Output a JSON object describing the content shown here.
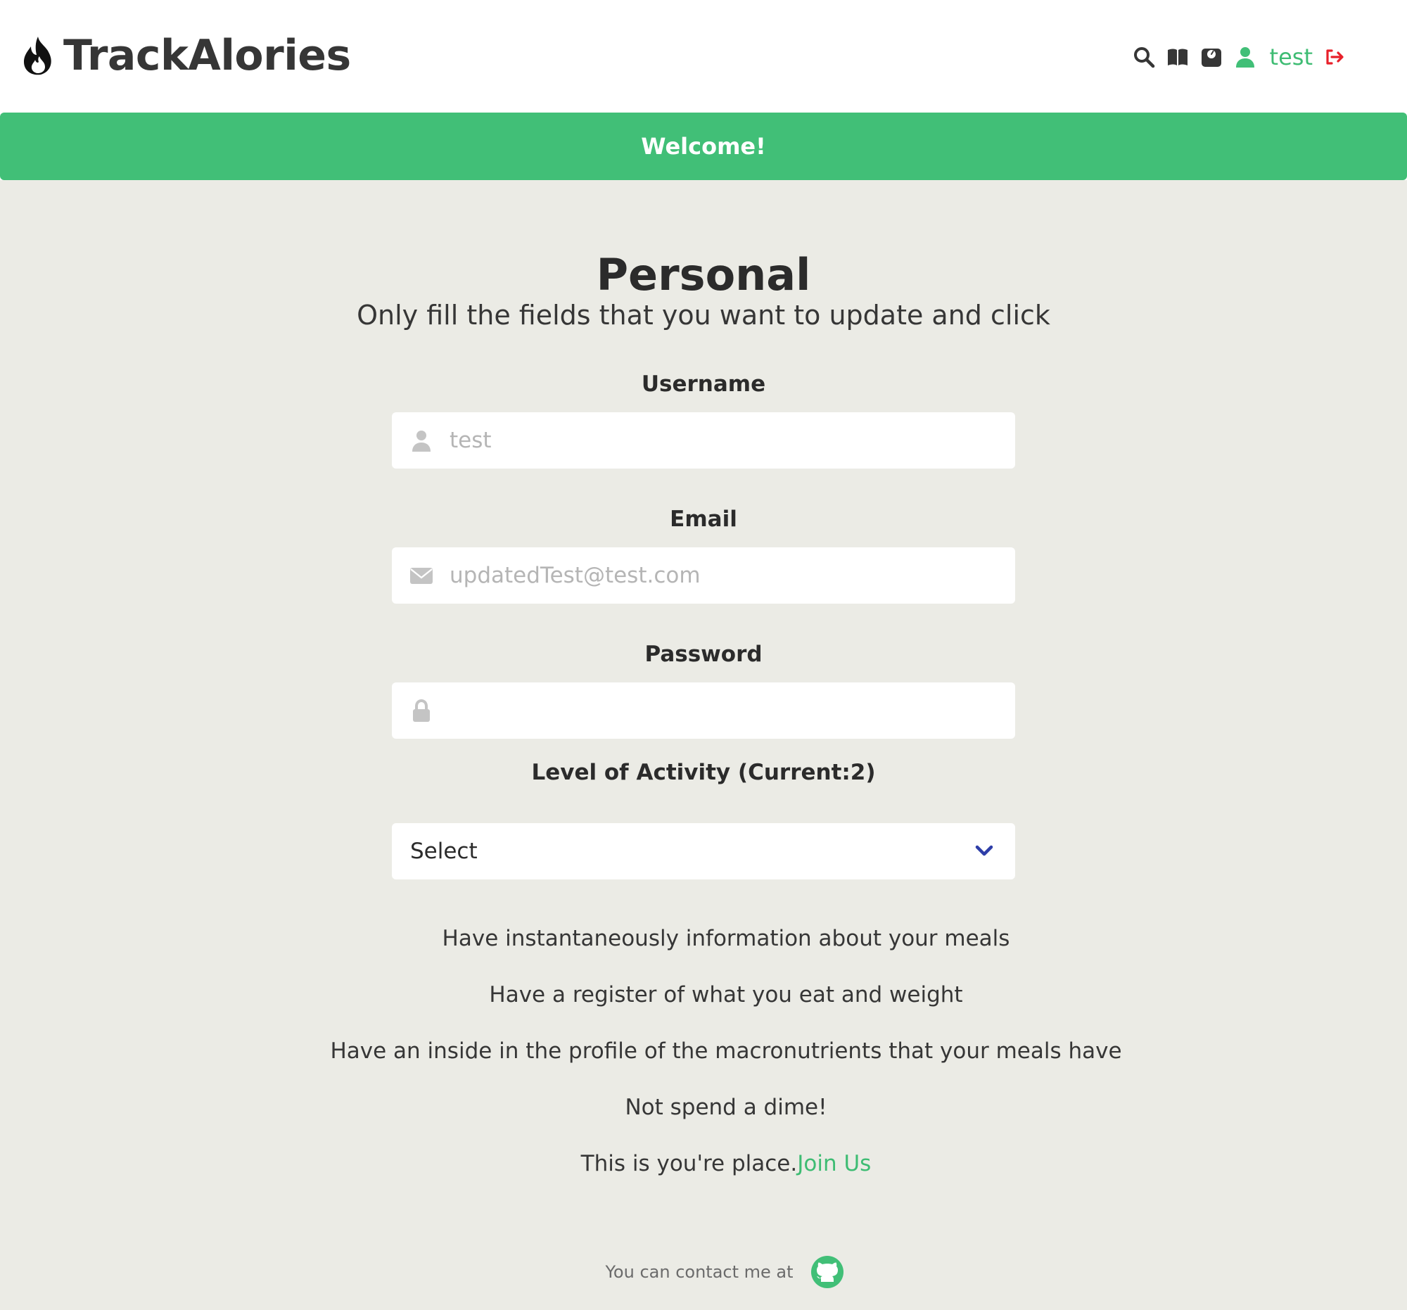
{
  "app": {
    "name": "TrackAlories",
    "logo_icon": "fire-icon"
  },
  "nav": {
    "icons": [
      "search-icon",
      "book-icon",
      "weight-scale-icon",
      "user-icon"
    ],
    "username": "test",
    "logout_icon": "sign-out-icon"
  },
  "banner": {
    "message": "Welcome!"
  },
  "form": {
    "title": "Personal",
    "subtitle": "Only fill the fields that you want to update and click",
    "username": {
      "label": "Username",
      "placeholder": "test",
      "value": "",
      "icon": "user-icon"
    },
    "email": {
      "label": "Email",
      "placeholder": "updatedTest@test.com",
      "value": "",
      "icon": "envelope-icon"
    },
    "password": {
      "label": "Password",
      "placeholder": "",
      "value": "",
      "icon": "lock-icon"
    },
    "activity": {
      "label": "Level of Activity (Current:2)",
      "selected": "Select"
    }
  },
  "features": [
    "Have instantaneously information about your meals",
    "Have a register of what you eat and weight",
    "Have an inside in the profile of the macronutrients that your meals have",
    "Not spend a dime!"
  ],
  "cta": {
    "text": "This is you're place.",
    "link": "Join Us"
  },
  "footer": {
    "text": "You can contact me at",
    "icon": "github-icon"
  },
  "colors": {
    "brand_green": "#41bf77",
    "link_green": "#3ebc73",
    "background": "#ebebe5",
    "logout_red": "#e8202a",
    "chevron_blue": "#2e3ea8"
  }
}
